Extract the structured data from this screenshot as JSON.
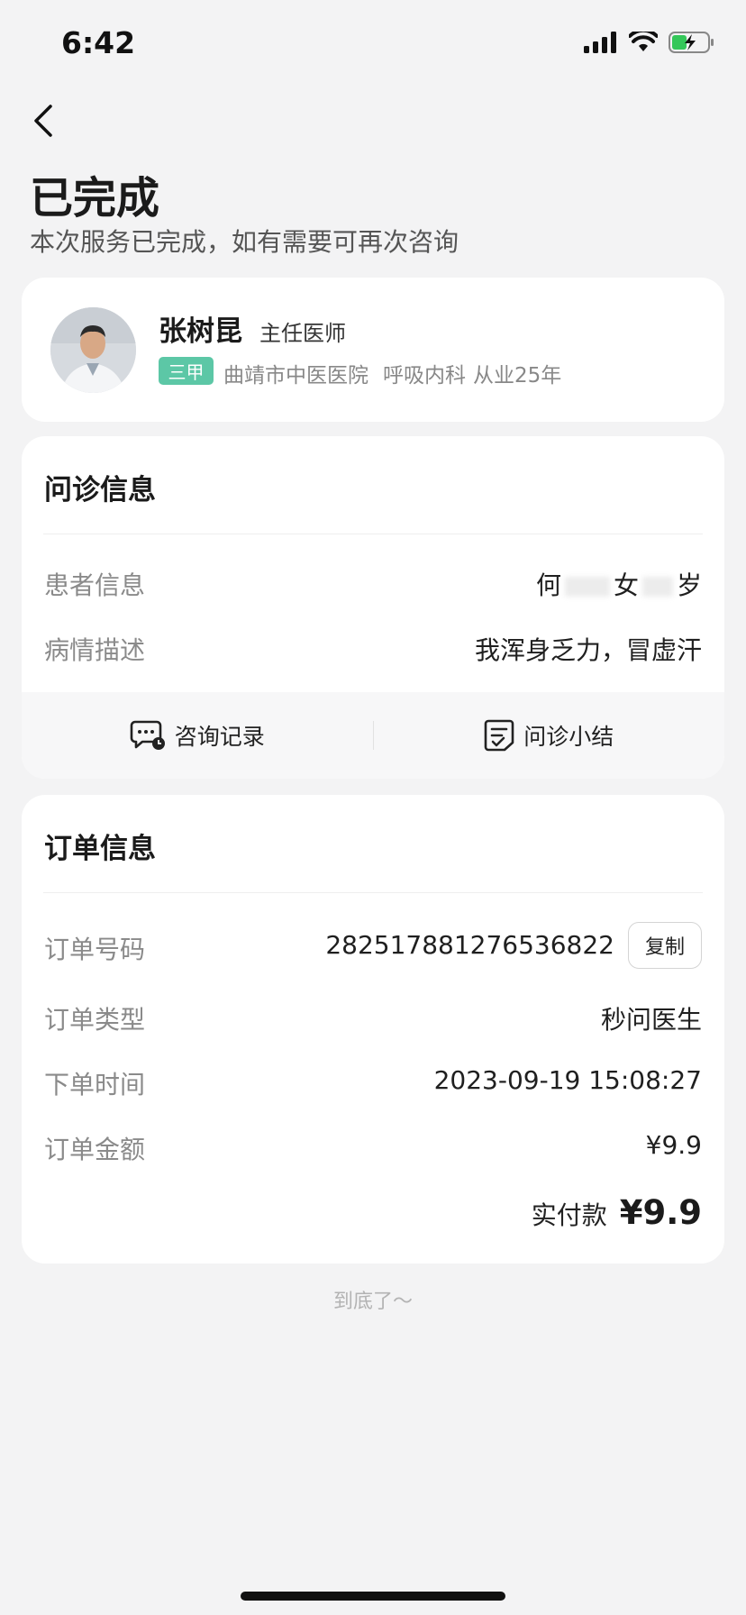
{
  "status_bar": {
    "time": "6:42"
  },
  "header": {
    "title": "已完成",
    "subtitle": "本次服务已完成，如有需要可再次咨询"
  },
  "doctor": {
    "name": "张树昆",
    "title": "主任医师",
    "tier": "三甲",
    "hospital": "曲靖市中医医院",
    "department": "呼吸内科",
    "experience": "从业25年"
  },
  "consultation": {
    "section_title": "问诊信息",
    "patient_label": "患者信息",
    "patient_name": "何",
    "patient_gender": "女",
    "patient_age_unit": "岁",
    "condition_label": "病情描述",
    "condition_value": "我浑身乏力，冒虚汗",
    "actions": {
      "record_label": "咨询记录",
      "summary_label": "问诊小结"
    }
  },
  "order": {
    "section_title": "订单信息",
    "number_label": "订单号码",
    "number_value": "282517881276536822",
    "copy_label": "复制",
    "type_label": "订单类型",
    "type_value": "秒问医生",
    "time_label": "下单时间",
    "time_value": "2023-09-19 15:08:27",
    "amount_label": "订单金额",
    "amount_value": "¥9.9",
    "paid_label": "实付款",
    "paid_value": "¥9.9"
  },
  "footer": {
    "end_note": "到底了～"
  },
  "colors": {
    "accent": "#5cc7a6",
    "battery": "#34c759"
  }
}
